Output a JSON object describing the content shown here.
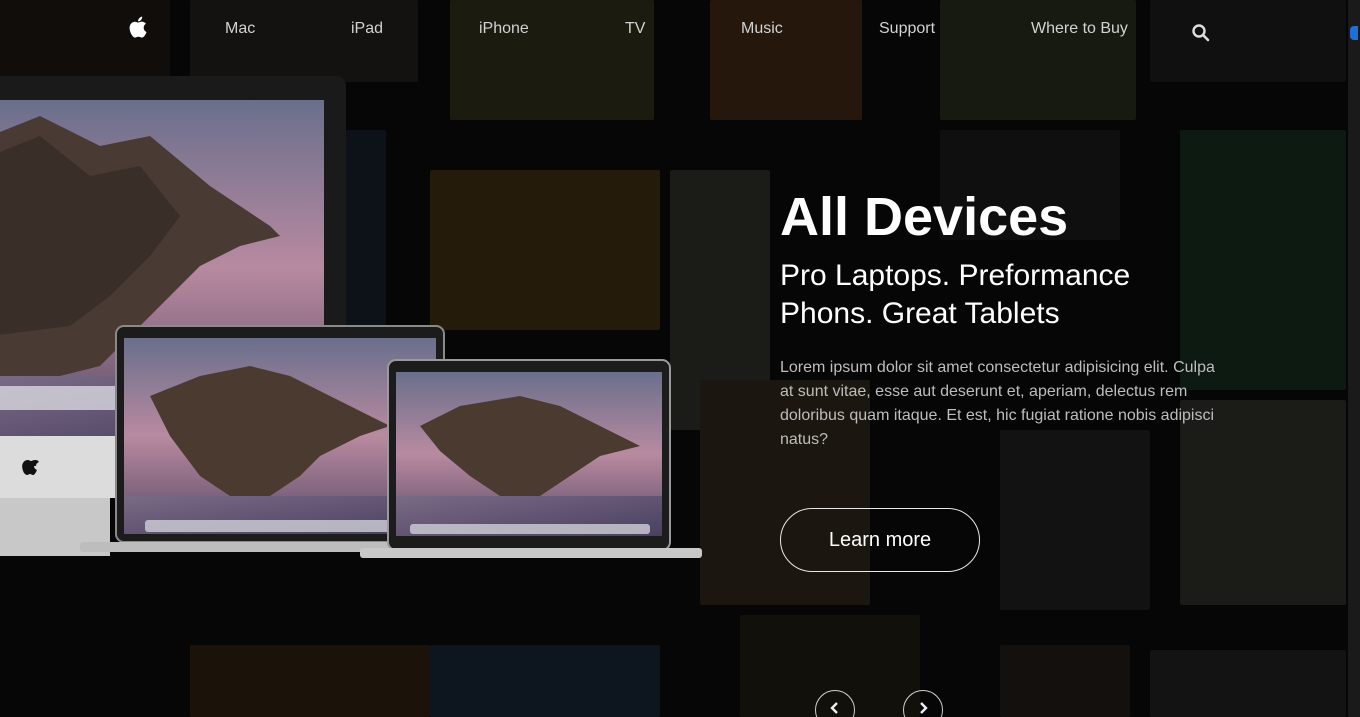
{
  "nav": {
    "logo_icon": "apple-logo-icon",
    "items": [
      "Mac",
      "iPad",
      "iPhone",
      "TV",
      "Music",
      "Support",
      "Where to Buy"
    ],
    "search_icon": "search-icon"
  },
  "hero": {
    "title": "All Devices",
    "subtitle_line1": "Pro Laptops. Preformance",
    "subtitle_line2": "Phons. Great Tablets",
    "body": "Lorem ipsum dolor sit amet consectetur adipisicing elit. Culpa at sunt vitae, esse aut deserunt et, aperiam, delectus rem doloribus quam itaque. Et est, hic fugiat ratione nobis adipisci natus?",
    "cta_label": "Learn more"
  },
  "carousel": {
    "prev_icon": "chevron-left-icon",
    "next_icon": "chevron-right-icon"
  },
  "colors": {
    "background": "#0a0a0a",
    "text_primary": "#ffffff",
    "text_muted": "#bdbdbd",
    "accent_scroll": "#1e6fd9"
  }
}
